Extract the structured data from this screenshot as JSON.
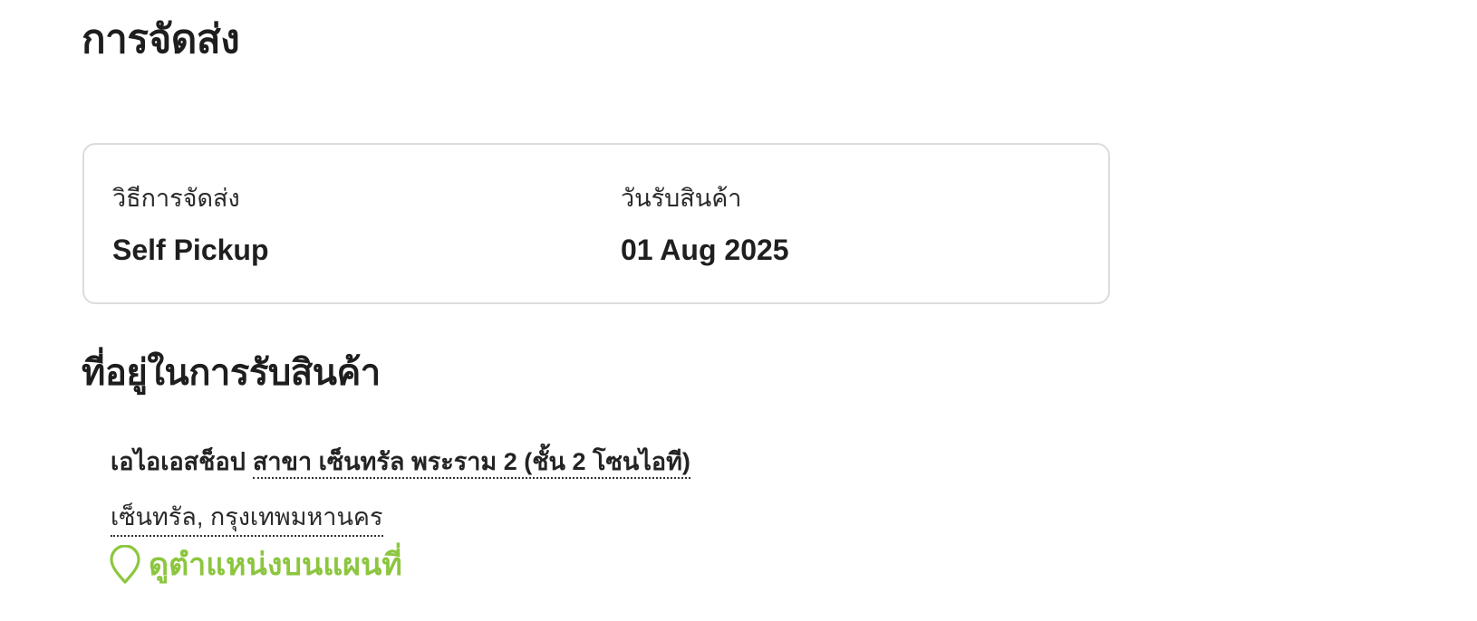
{
  "delivery": {
    "title": "การจัดส่ง",
    "method_label": "วิธีการจัดส่ง",
    "method_value": "Self Pickup",
    "date_label": "วันรับสินค้า",
    "date_value": "01 Aug 2025"
  },
  "pickup_address": {
    "title": "ที่อยู่ในการรับสินค้า",
    "store_name": "เอไอเอสช็อป",
    "branch": "สาขา เซ็นทรัล พระราม 2 (ชั้น 2 โซนไอที)",
    "area": "เซ็นทรัล, กรุงเทพมหานคร",
    "map_link_label": "ดูตำแหน่งบนแผนที่",
    "map_icon": "map-pin-icon"
  },
  "colors": {
    "accent_green": "#8cc63f",
    "text_dark": "#1e1e1e",
    "card_border": "#dcdcdc"
  }
}
